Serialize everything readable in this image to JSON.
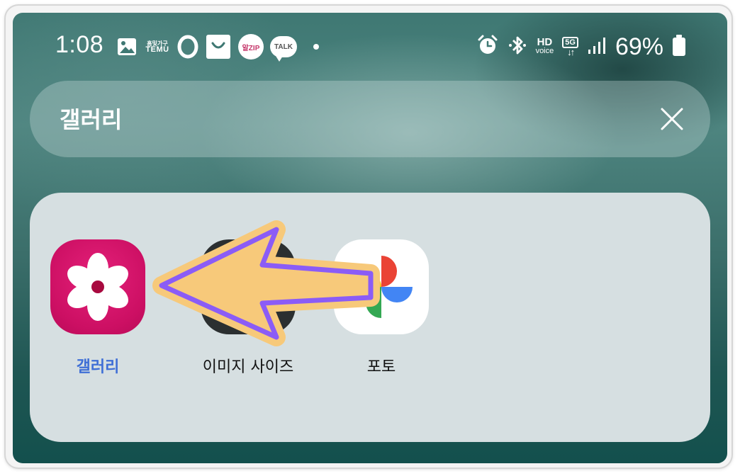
{
  "status_bar": {
    "time": "1:08",
    "notification_icons": [
      "image-icon",
      "temu-icon",
      "opera-icon",
      "shopping-bag-icon",
      "alzip-icon",
      "kakaotalk-icon",
      "more-dot-icon"
    ],
    "temu_line1": "홈및가구",
    "temu_line2": "TEMU",
    "alzip_label": "알ZIP",
    "talk_label": "TALK",
    "hd_top": "HD",
    "hd_bottom": "voice",
    "network": "5G",
    "network_arrows": "↓↑",
    "battery_percent": "69%"
  },
  "search": {
    "query": "갤러리"
  },
  "results": {
    "apps": [
      {
        "label": "갤러리",
        "icon": "gallery-flower-icon",
        "highlighted": true
      },
      {
        "label": "이미지 사이즈",
        "icon": "image-size-icon",
        "highlighted": false
      },
      {
        "label": "포토",
        "icon": "google-photos-icon",
        "highlighted": false
      }
    ]
  },
  "annotation": {
    "arrow_color": "#f7c97a",
    "arrow_outline": "#8b5cf6",
    "direction": "left"
  },
  "colors": {
    "gallery_icon": "#d4146a",
    "highlight_label": "#3f6fd6"
  }
}
